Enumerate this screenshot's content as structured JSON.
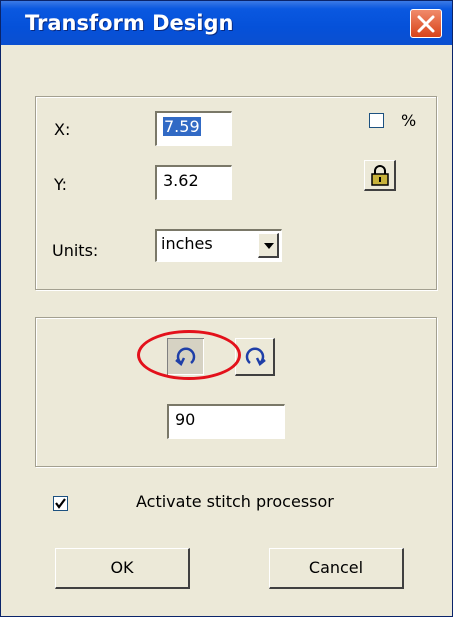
{
  "window": {
    "title": "Transform Design",
    "close_label": "✕"
  },
  "position": {
    "x_label": "X:",
    "x_value": "7.59",
    "y_label": "Y:",
    "y_value": "3.62",
    "percent_label": "%",
    "percent_checked": false,
    "lock_icon": "padlock-icon",
    "units_label": "Units:",
    "units_value": "inches"
  },
  "rotate": {
    "ccw_icon": "rotate-counterclockwise-icon",
    "cw_icon": "rotate-clockwise-icon",
    "angle_value": "90"
  },
  "stitch": {
    "checked": true,
    "label": "Activate stitch processor"
  },
  "buttons": {
    "ok": "OK",
    "cancel": "Cancel"
  },
  "colors": {
    "titlebar": "#0551d9",
    "highlight": "#e3111b",
    "dialog_bg": "#ece9d8"
  }
}
